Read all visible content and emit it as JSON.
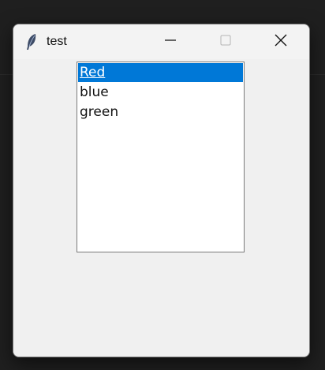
{
  "window": {
    "title": "test"
  },
  "listbox": {
    "items": [
      {
        "label": "Red",
        "selected": true
      },
      {
        "label": "blue",
        "selected": false
      },
      {
        "label": "green",
        "selected": false
      }
    ]
  },
  "colors": {
    "selection": "#0078d7",
    "window_bg": "#f0f0f0",
    "desktop_bg": "#1f1f1f"
  },
  "icons": {
    "app": "feather-icon",
    "minimize": "minimize-icon",
    "maximize": "maximize-icon",
    "close": "close-icon"
  }
}
